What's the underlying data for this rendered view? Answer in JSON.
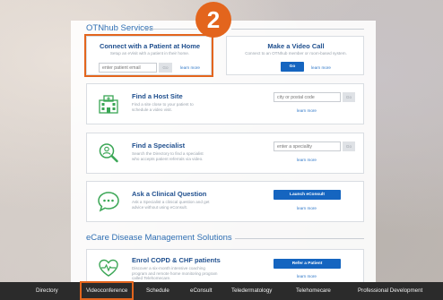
{
  "sections": {
    "services_title": "OTNhub Services",
    "ecare_title": "eCare Disease Management Solutions"
  },
  "cards": {
    "connect": {
      "title": "Connect with a Patient at Home",
      "desc": "Setup an eVisit with a patient in their home.",
      "placeholder": "enter patient email",
      "go": "Go",
      "link": "learn more"
    },
    "video_call": {
      "title": "Make a Video Call",
      "desc": "Connect to an OTNhub member or room-based system.",
      "button": "Go",
      "link": "learn more"
    },
    "host_site": {
      "title": "Find a Host Site",
      "desc": "Find a site close to your patient to schedule a video visit.",
      "placeholder": "city or postal code",
      "go": "Go",
      "link": "learn more"
    },
    "specialist": {
      "title": "Find a Specialist",
      "desc": "Search the Directory to find a specialist who accepts patient referrals via video.",
      "placeholder": "enter a speciality",
      "go": "Go",
      "link": "learn more"
    },
    "clinical_question": {
      "title": "Ask a Clinical Question",
      "desc": "Ask a Specialist a clinical question and get advice without using eConsult.",
      "button": "Launch eConsult",
      "link": "learn more"
    },
    "copd": {
      "title": "Enrol COPD & CHF patients",
      "desc": "Discover a six-month intensive coaching program and remote home monitoring program called Telehomecare.",
      "button": "Refer a Patient",
      "link": "learn more"
    }
  },
  "nav": {
    "items": [
      "Directory",
      "Videoconference",
      "Schedule",
      "eConsult",
      "Teledermatology",
      "Telehomecare",
      "Professional Development"
    ]
  },
  "callout": {
    "number": "2"
  },
  "colors": {
    "accent_orange": "#e3651d",
    "brand_blue": "#1565c0",
    "title_blue": "#1f4f8e",
    "icon_green": "#3aa655",
    "nav_bg": "#2b2b2b"
  },
  "icons": {
    "host_site": "hospital-building-icon",
    "specialist": "magnifier-person-icon",
    "clinical_question": "speech-bubble-icon",
    "copd": "heart-pulse-icon"
  }
}
